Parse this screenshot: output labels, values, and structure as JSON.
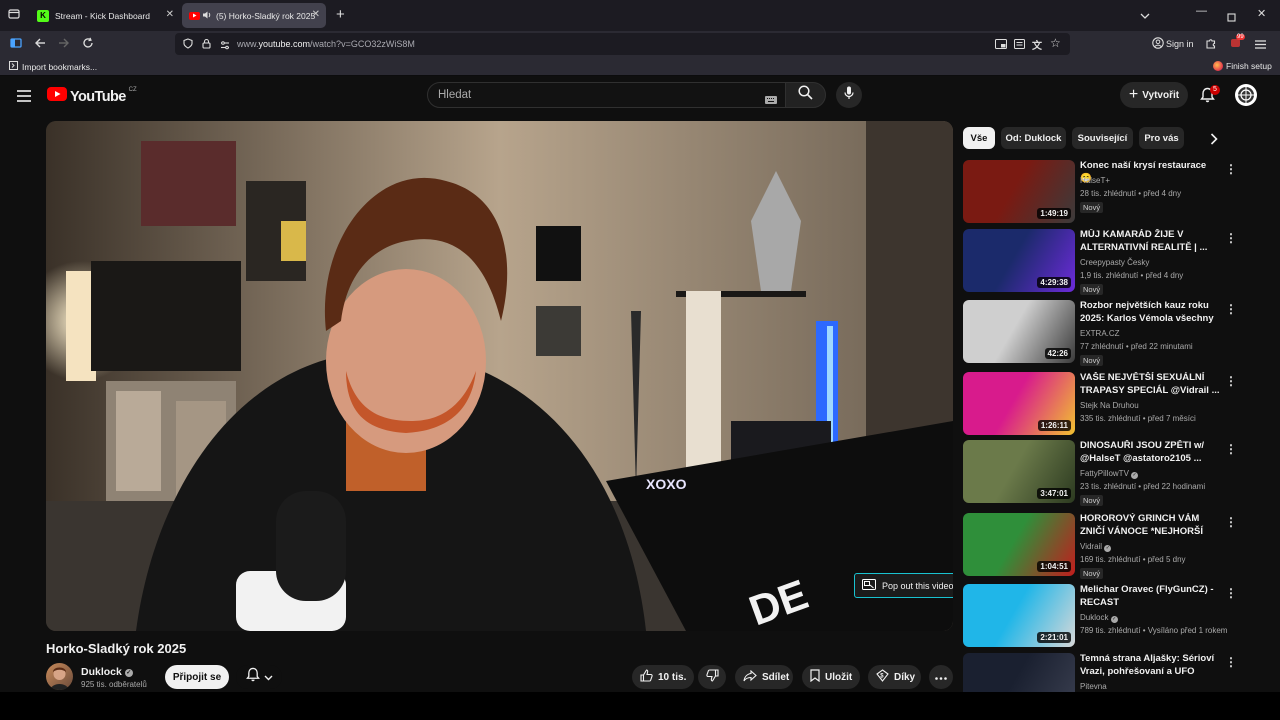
{
  "browser": {
    "tabs": [
      {
        "label": "Stream - Kick Dashboard",
        "favicon": "kick-icon"
      },
      {
        "label": "(5) Horko-Sladký rok 2025",
        "favicon": "youtube-icon",
        "audio": true
      }
    ],
    "url_prefix": "www.",
    "url_domain": "youtube.com",
    "url_path": "/watch?v=GCO32zWiS8M",
    "bookmarks": {
      "import_label": "Import bookmarks...",
      "finish_label": "Finish setup"
    },
    "sign_in_label": "Sign in",
    "ext_badge": "99"
  },
  "youtube": {
    "logo_text": "YouTube",
    "region": "CZ",
    "search_placeholder": "Hledat",
    "create_label": "Vytvořit",
    "notif_count": "5"
  },
  "video": {
    "title": "Horko-Sladký rok 2025",
    "popout_label": "Pop out this video",
    "channel": "Duklock",
    "subscribers": "925 tis. odběratelů",
    "join_label": "Připojit se",
    "likes": "10 tis.",
    "share_label": "Sdílet",
    "save_label": "Uložit",
    "thanks_label": "Díky"
  },
  "sidebar": {
    "chips": [
      "Vše",
      "Od: Duklock",
      "Související",
      "Pro vás"
    ],
    "recommendations": [
      {
        "title": "Konec naší krysí restaurace 😁",
        "channel": "HalseT+",
        "meta": "28 tis. zhlédnutí • před 4 dny",
        "duration": "1:49:19",
        "new": "Nový",
        "verified": false,
        "colors": [
          "#7a1a12",
          "#3b3b3b"
        ]
      },
      {
        "title": "MŮJ KAMARÁD ŽIJE V ALTERNATIVNÍ REALITĚ | ...",
        "channel": "Creepypasty Česky",
        "meta": "1,9 tis. zhlédnutí • před 4 dny",
        "duration": "4:29:38",
        "new": "Nový",
        "verified": false,
        "colors": [
          "#1b2a6b",
          "#6c2bd9"
        ]
      },
      {
        "title": "Rozbor největších kauz roku 2025: Karlos Vémola všechny ...",
        "channel": "EXTRA.CZ",
        "meta": "77 zhlédnutí • před 22 minutami",
        "duration": "42:26",
        "new": "Nový",
        "verified": false,
        "colors": [
          "#cfcfcf",
          "#3a3a3a"
        ]
      },
      {
        "title": "VAŠE NEJVĚTŠÍ SEXUÁLNÍ TRAPASY SPECIÁL @Vidrail ...",
        "channel": "Stejk Na Druhou",
        "meta": "335 tis. zhlédnutí • před 7 měsíci",
        "duration": "1:26:11",
        "new": "",
        "verified": false,
        "colors": [
          "#d81b8c",
          "#f2c230"
        ]
      },
      {
        "title": "DINOSAUŘI JSOU ZPĚTI w/ @HalseT @astatoro2105 ...",
        "channel": "FattyPillowTV",
        "meta": "23 tis. zhlédnutí • před 22 hodinami",
        "duration": "3:47:01",
        "new": "Nový",
        "verified": true,
        "colors": [
          "#6b7a4a",
          "#2c3a20"
        ]
      },
      {
        "title": "HOROROVÝ GRINCH VÁM ZNIČÍ VÁNOCE *NEJHORŠÍ FILM*",
        "channel": "Vidrail",
        "meta": "169 tis. zhlédnutí • před 5 dny",
        "duration": "1:04:51",
        "new": "Nový",
        "verified": true,
        "colors": [
          "#2f8f3a",
          "#c21d1d"
        ]
      },
      {
        "title": "Melichar Oravec (FlyGunCZ) - RECAST",
        "channel": "Duklock",
        "meta": "789 tis. zhlédnutí • Vysíláno před 1 rokem",
        "duration": "2:21:01",
        "new": "",
        "verified": true,
        "colors": [
          "#20b6e8",
          "#d8d8d8"
        ]
      },
      {
        "title": "Temná strana Aljašky: Sérioví Vrazi, pohřešovaní a UFO",
        "channel": "Pitevna",
        "meta": "",
        "duration": "",
        "new": "",
        "verified": false,
        "colors": [
          "#1a2030",
          "#3a3f50"
        ]
      }
    ]
  }
}
